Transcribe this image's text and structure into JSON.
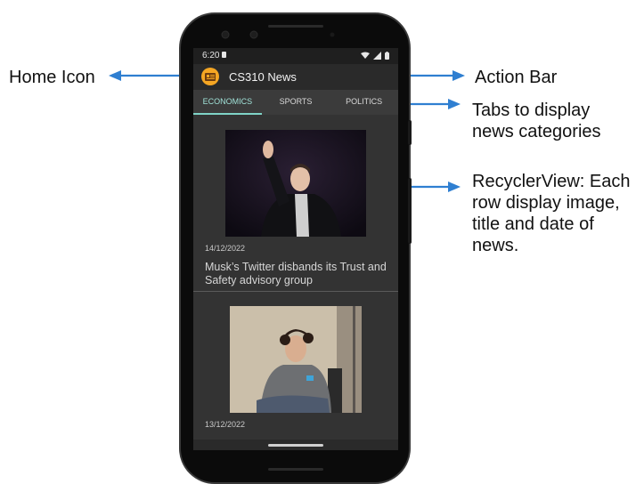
{
  "annotations": {
    "home_icon": "Home Icon",
    "action_bar": "Action Bar",
    "tabs": "Tabs to display news categories",
    "recycler": "RecyclerView: Each row display image, title and date of news."
  },
  "status_bar": {
    "time": "6:20"
  },
  "action_bar": {
    "title": "CS310 News",
    "home_icon": "newspaper-icon"
  },
  "tabs": [
    {
      "label": "ECONOMICS",
      "active": true
    },
    {
      "label": "SPORTS",
      "active": false
    },
    {
      "label": "POLITICS",
      "active": false
    }
  ],
  "news": [
    {
      "date": "14/12/2022",
      "title": "Musk’s Twitter disbands its Trust and Safety advisory group"
    },
    {
      "date": "13/12/2022",
      "title": ""
    }
  ],
  "colors": {
    "accent": "#7fd3c7",
    "home_icon": "#f5a623",
    "arrow": "#2f7fd1"
  }
}
